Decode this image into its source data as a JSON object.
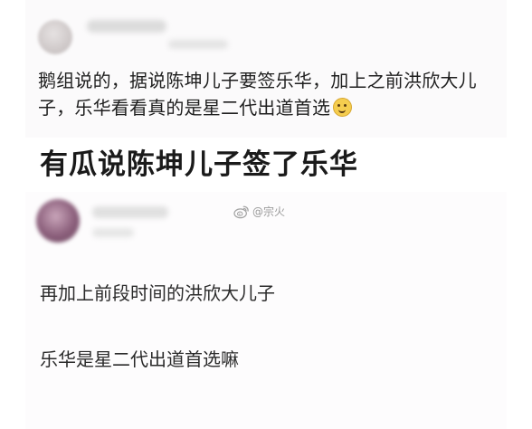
{
  "top_post": {
    "text": "鹅组说的，据说陈坤儿子要签乐华，加上之前洪欣大儿子，乐华看看真的是星二代出道首选",
    "emoji": "smile-emoji"
  },
  "headline": {
    "text": "有瓜说陈坤儿子签了乐华"
  },
  "watermark": {
    "text": "@宗火",
    "icon": "weibo-icon"
  },
  "bottom_post": {
    "line1": "再加上前段时间的洪欣大儿子",
    "line2": "乐华是星二代出道首选嘛"
  },
  "colors": {
    "text": "#1f1f1f",
    "watermark": "#9a9a9a",
    "card_background": "#fbfafb"
  }
}
